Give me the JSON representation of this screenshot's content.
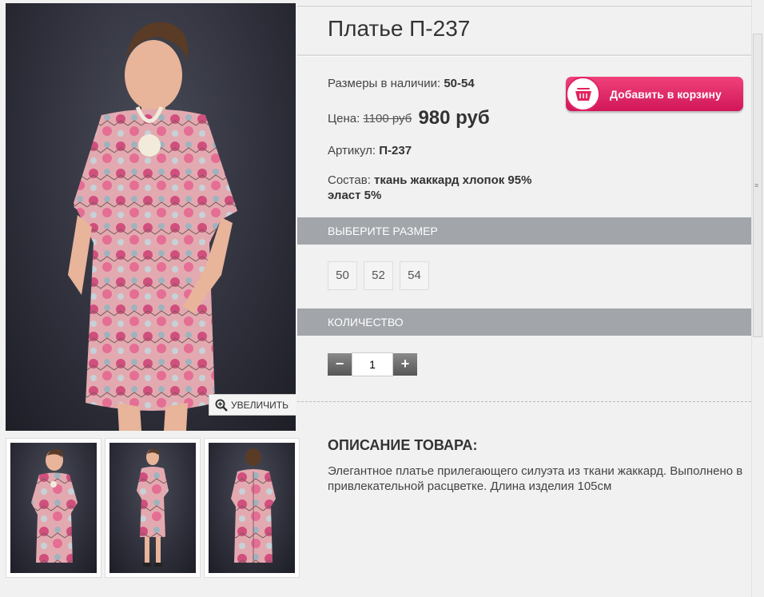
{
  "product": {
    "title": "Платье П-237",
    "sizes_label": "Размеры в наличии:",
    "sizes_value": "50-54",
    "price_label": "Цена:",
    "old_price": "1100 руб",
    "new_price": "980 руб",
    "article_label": "Артикул:",
    "article_value": "П-237",
    "composition_label": "Состав:",
    "composition_value": "ткань жаккард хлопок 95% эласт 5%"
  },
  "cart_button": {
    "label": "Добавить в корзину",
    "icon": "basket-icon",
    "color": "#e0245e"
  },
  "gallery": {
    "zoom_label": "УВЕЛИЧИТЬ",
    "zoom_icon": "magnifier-plus-icon",
    "thumbnails": [
      "front",
      "full-length",
      "back"
    ]
  },
  "size_section": {
    "title": "ВЫБЕРИТЕ РАЗМЕР",
    "options": [
      "50",
      "52",
      "54"
    ]
  },
  "quantity_section": {
    "title": "КОЛИЧЕСТВО",
    "minus": "−",
    "plus": "+",
    "value": "1"
  },
  "description": {
    "title": "ОПИСАНИЕ ТОВАРА:",
    "text": "Элегантное платье прилегающего силуэта из ткани жаккард. Выполнено в привлекательной расцветке. Длина изделия 105см"
  },
  "colors": {
    "accent": "#e0245e",
    "section_bar": "#a2a5aa",
    "background": "#f1f1f1"
  }
}
